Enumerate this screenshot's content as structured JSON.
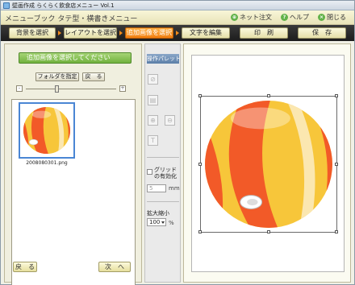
{
  "window": {
    "title": "壁画作成 らくらく飲食店メニュー Vol.1"
  },
  "header": {
    "menu_title": "メニューブック タテ型・横書きメニュー",
    "net_order": "ネット注文",
    "help": "ヘルプ",
    "close": "閉じる"
  },
  "steps": {
    "background": "背景を選択",
    "layout": "レイアウトを選択",
    "add_image": "追加画像を選択",
    "edit_text": "文字を編集",
    "print": "印　刷",
    "save": "保　存"
  },
  "left_panel": {
    "prompt": "追加画像を選択してください",
    "folder_button": "フォルダを指定",
    "back_button_small": "戻　る",
    "zoom_minus": "-",
    "zoom_plus": "+",
    "file_name": "2008080301.png",
    "back_button": "戻　る",
    "next_button": "次　へ"
  },
  "palette": {
    "title": "操作パレット",
    "grid_label": "グリッド の有効化",
    "grid_value": "5",
    "grid_unit": "mm",
    "zoom_label": "拡大縮小",
    "zoom_value": "100",
    "zoom_unit": "%"
  },
  "icons": [
    "app-icon",
    "net-order-icon",
    "help-icon",
    "close-icon",
    "tool-icons"
  ],
  "colors": {
    "active_step": "#f07e10",
    "prompt_green": "#72b23e",
    "palette_header": "#5b7ea8",
    "ball_orange": "#f25a28",
    "ball_yellow": "#f7c63a"
  }
}
